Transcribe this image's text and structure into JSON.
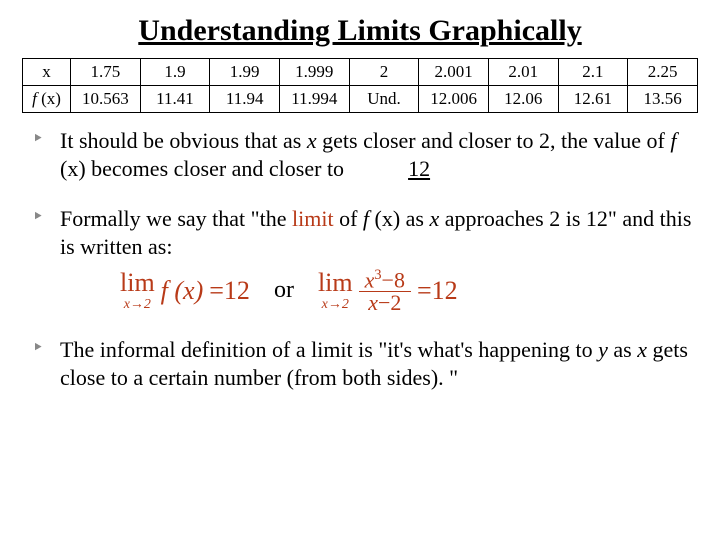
{
  "title": "Understanding Limits Graphically",
  "table": {
    "row_labels": {
      "x": "x",
      "fx_f": "f ",
      "fx_paren": "(x)"
    },
    "x": [
      "1.75",
      "1.9",
      "1.99",
      "1.999",
      "2",
      "2.001",
      "2.01",
      "2.1",
      "2.25"
    ],
    "fx": [
      "10.563",
      "11.41",
      "11.94",
      "11.994",
      "Und.",
      "12.006",
      "12.06",
      "12.61",
      "13.56"
    ]
  },
  "bullets": {
    "b1_a": "It should be obvious that as ",
    "b1_x": "x",
    "b1_b": " gets closer and closer to 2, the value of ",
    "b1_f": "f ",
    "b1_paren": "(x)",
    "b1_c": " becomes closer and closer to",
    "b1_ans": "12",
    "b2_a": "Formally we say that \"the ",
    "b2_limit": "limit",
    "b2_b": " of ",
    "b2_f": "f ",
    "b2_paren": "(x)",
    "b2_c": " as ",
    "b2_x": "x",
    "b2_d": " approaches 2 is 12\" and this is written as:",
    "b3_a": "The informal definition of a limit is \"it's what's happening to ",
    "b3_y": "y",
    "b3_b": " as ",
    "b3_x": "x",
    "b3_c": " gets close to a certain number (from both sides). \""
  },
  "formula": {
    "lim": "lim",
    "sub": "x→2",
    "fx": "f (x)",
    "eq12": "=12",
    "or": "or",
    "num": "x",
    "num_sup": "3",
    "num_rest": "−8",
    "den": "x−2"
  }
}
